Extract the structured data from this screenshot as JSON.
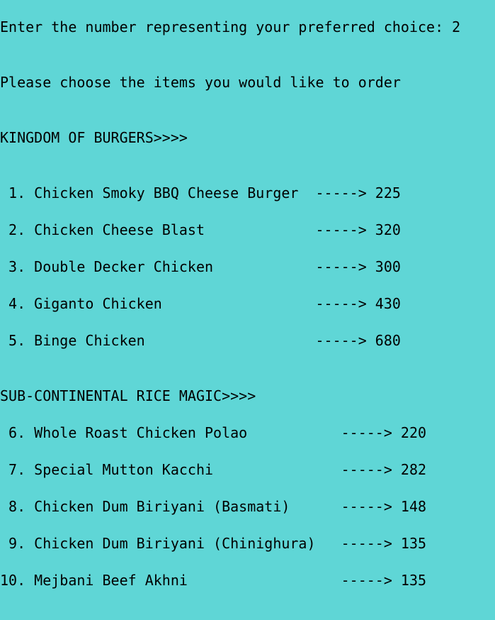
{
  "console": {
    "prompt_line": "Enter the number representing your preferred choice: 2",
    "instruction_line": "Please choose the items you would like to order",
    "burgers_header": "KINGDOM OF BURGERS>>>>",
    "burger_items": [
      " 1. Chicken Smoky BBQ Cheese Burger  -----> 225",
      " 2. Chicken Cheese Blast             -----> 320",
      " 3. Double Decker Chicken            -----> 300",
      " 4. Giganto Chicken                  -----> 430",
      " 5. Binge Chicken                    -----> 680"
    ],
    "rice_header": "SUB-CONTINENTAL RICE MAGIC>>>>",
    "rice_items": [
      " 6. Whole Roast Chicken Polao           -----> 220",
      " 7. Special Mutton Kacchi               -----> 282",
      " 8. Chicken Dum Biriyani (Basmati)      -----> 148",
      " 9. Chicken Dum Biriyani (Chinighura)   -----> 135",
      "10. Mejbani Beef Akhni                  -----> 135"
    ]
  }
}
